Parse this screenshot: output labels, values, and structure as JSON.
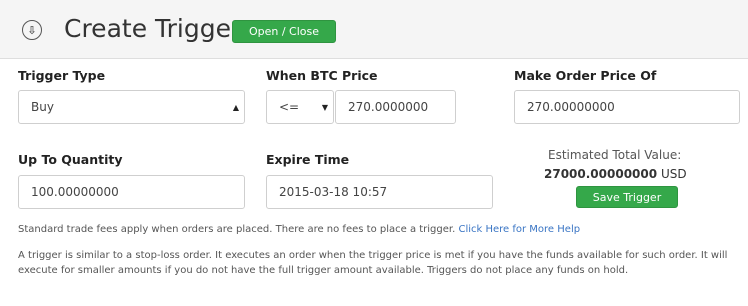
{
  "header": {
    "title": "Create Trigger",
    "toggle_label": "Open / Close",
    "icon": "circle-arrow-icon"
  },
  "form": {
    "trigger_type": {
      "label": "Trigger Type",
      "value": "Buy"
    },
    "when_price": {
      "label": "When BTC Price",
      "operator": "<=",
      "value": "270.0000000"
    },
    "make_order_price": {
      "label": "Make Order Price Of",
      "value": "270.00000000"
    },
    "quantity": {
      "label": "Up To Quantity",
      "value": "100.00000000"
    },
    "expire": {
      "label": "Expire Time",
      "value": "2015-03-18 10:57"
    }
  },
  "estimate": {
    "label": "Estimated Total Value:",
    "value": "27000.00000000",
    "currency": "USD"
  },
  "save_label": "Save Trigger",
  "fees_note": {
    "text": "Standard trade fees apply when orders are placed. There are no fees to place a trigger.",
    "link": "Click Here for More Help"
  },
  "description": "A trigger is similar to a stop-loss order. It executes an order when the trigger price is met if you have the funds available for such order. It will execute for smaller amounts if you do not have the full trigger amount available. Triggers do not place any funds on hold.",
  "colors": {
    "accent": "#35a84a",
    "link": "#3a75c4"
  }
}
